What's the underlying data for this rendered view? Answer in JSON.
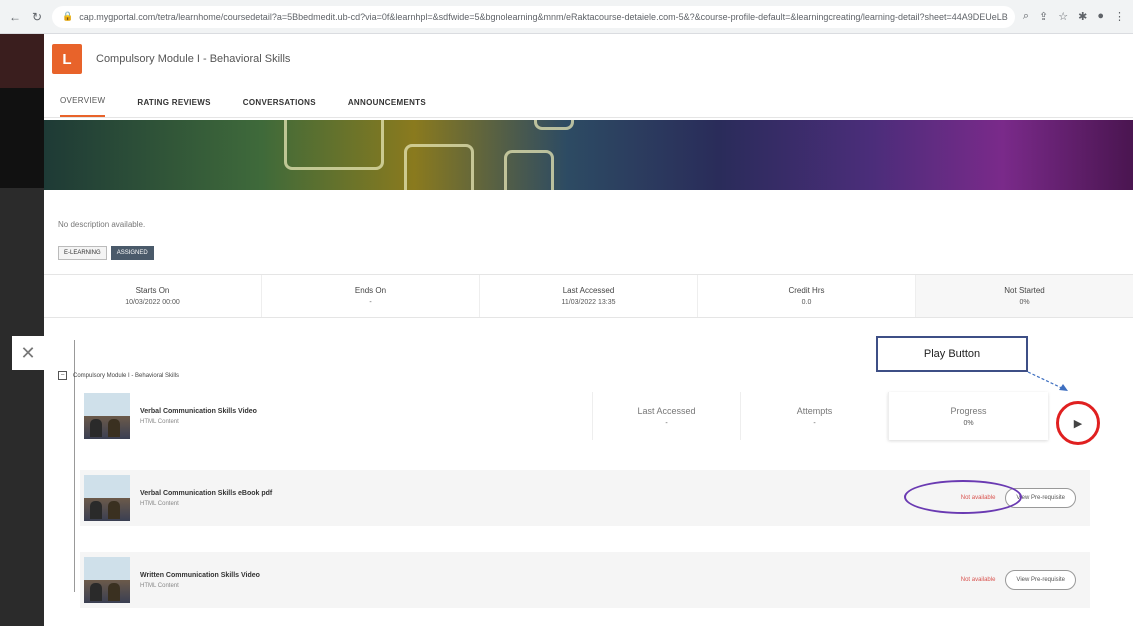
{
  "browser": {
    "url": "cap.mygportal.com/tetra/learnhome/coursedetail?a=5Bbedmedit.ub-cd?via=0f&learnhpl=&sdfwide=5&bgnolearning&mnm/eRaktacourse-detaiele.com-5&?&course-profile-default=&learningcreating/learning-detail?sheet=44A9DEUeLB",
    "back_icon": "back-arrow-icon",
    "reload_icon": "reload-icon"
  },
  "course": {
    "title": "Compulsory Module I - Behavioral Skills",
    "logo_text": "L"
  },
  "tabs": [
    {
      "label": "OVERVIEW",
      "active": true
    },
    {
      "label": "RATING REVIEWS",
      "active": false
    },
    {
      "label": "CONVERSATIONS",
      "active": false
    },
    {
      "label": "ANNOUNCEMENTS",
      "active": false
    }
  ],
  "description": "No description available.",
  "badges": [
    "E-LEARNING",
    "ASSIGNED"
  ],
  "stats": [
    {
      "label": "Starts On",
      "value": "10/03/2022 00:00"
    },
    {
      "label": "Ends On",
      "value": "-"
    },
    {
      "label": "Last Accessed",
      "value": "11/03/2022 13:35"
    },
    {
      "label": "Credit Hrs",
      "value": "0.0"
    },
    {
      "label": "Not Started",
      "value": "0%"
    }
  ],
  "module": {
    "toggle": "−",
    "title": "Compulsory Module I - Behavioral Skills"
  },
  "items": [
    {
      "name": "Verbal Communication Skills Video",
      "type": "HTML Content",
      "columns": [
        {
          "label": "Last Accessed",
          "value": "-"
        },
        {
          "label": "Attempts",
          "value": "-"
        },
        {
          "label": "Progress",
          "value": "0%"
        }
      ]
    },
    {
      "name": "Verbal Communication Skills eBook pdf",
      "type": "HTML Content",
      "status": "Not available",
      "prereq_label": "View Pre-requisite"
    },
    {
      "name": "Written Communication Skills Video",
      "type": "HTML Content",
      "status": "Not available",
      "prereq_label": "View Pre-requisite"
    }
  ],
  "play_button": {
    "glyph": "▶",
    "icon": "play-icon"
  },
  "callout": {
    "label": "Play Button"
  },
  "colors": {
    "accent": "#e8632a",
    "highlight_circle": "#e02020",
    "highlight_ellipse": "#6a3ab2",
    "callout_border": "#3e4f86"
  }
}
